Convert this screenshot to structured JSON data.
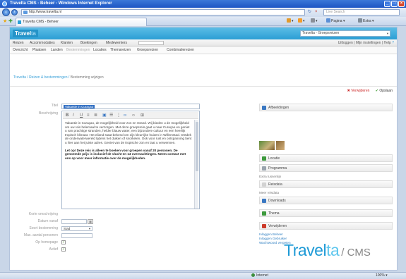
{
  "browser": {
    "title": "Travelta CMS - Beheer - Windows Internet Explorer",
    "url": "http://www.travelta.nl",
    "search_placeholder": "Live Search",
    "tab_title": "Travelta CMS - Beheer",
    "commands": [
      "Pagina",
      "Extra"
    ],
    "status_zone": "Internet",
    "zoom": "100%"
  },
  "app": {
    "logo_main": "Travel",
    "logo_accent": "ta",
    "site_select": "Travelta - Groepsreizen",
    "menu": [
      "Reizen",
      "Accommodaties",
      "Klanten",
      "Boekingen",
      "Medewerkers"
    ],
    "menu_right": [
      "Uitloggen",
      "Mijn instellingen"
    ],
    "menu_help": "Help",
    "submenu": [
      "Overzicht",
      "Plaatsen",
      "Landen",
      "Bestemmingen",
      "Locaties",
      "Themareizen",
      "Groepsreizen",
      "Combinatiereizen"
    ],
    "breadcrumb": {
      "home": "Travelta",
      "section": "Reizen & bestemmingen",
      "current": "Bestemming wijzigen"
    },
    "actions": {
      "delete": "Verwijderen",
      "save": "Opslaan"
    }
  },
  "form": {
    "labels": {
      "title": "Titel",
      "description": "Beschrijving",
      "short_description": "Korte omschrijving",
      "start_date": "Datum vanaf",
      "destination_type": "Soort bestemming",
      "max_persons": "Max. aantal personen",
      "show_online": "Op homepage",
      "active": "Actief"
    },
    "title_value": "Vakantie in Curaçao",
    "editor_paragraphs": [
      "Vakantie in Curaçao, de mogelijkheid voor zon en strand. Wij bieden u de mogelijkheid om uw reis helemaal te verzorgen. Met deze groepsreis gaat u naar Curaçao en geniet u van prachtige stranden, helder blauw water, een bijzondere cultuur en een heerlijk tropisch klimaat. Het eiland staat bekend om zijn kleurrijke huizen in Willemstad. Ontdek de onderwaterwereld tijdens het duiken of snorkelen. Ook voor rust en ontspanning bent u hier aan het juiste adres. Geniet van de tropische zon en laat u verwennen."
    ],
    "editor_bold": "Let op! Deze reis is alleen te boeken voor groepen vanaf 20 personen. De genoemde prijs is inclusief de vlucht en 14 overnachtingen. Neem contact met ons op voor meer informatie over de mogelijkheden.",
    "destination_type_value": "Stad"
  },
  "sidebar": {
    "panels": [
      {
        "label": "Afbeeldingen",
        "icon_color": "#3a78c2"
      },
      {
        "label": "Locatie",
        "icon_color": "#3d9a3d"
      },
      {
        "label": "Programma",
        "icon_color": "#9aa4ae"
      },
      {
        "label": "Reisdata",
        "icon_color": "#d2d2d2"
      },
      {
        "label": "Downloads",
        "icon_color": "#3a78c2"
      },
      {
        "label": "Thema",
        "icon_color": "#3d9a3d"
      },
      {
        "label": "Verwijderen",
        "icon_color": "#cc3a2a"
      }
    ],
    "labels": {
      "after_location": "Extra tussenlijn",
      "after_reisdata": "Meer reisdata"
    },
    "links": [
      "Inloggen Beheer",
      "Inloggen Gebruiker",
      "Wachtwoord vergeten"
    ]
  },
  "branding": {
    "main": "Travel",
    "accent": "ta",
    "suffix": "/ CMS"
  }
}
